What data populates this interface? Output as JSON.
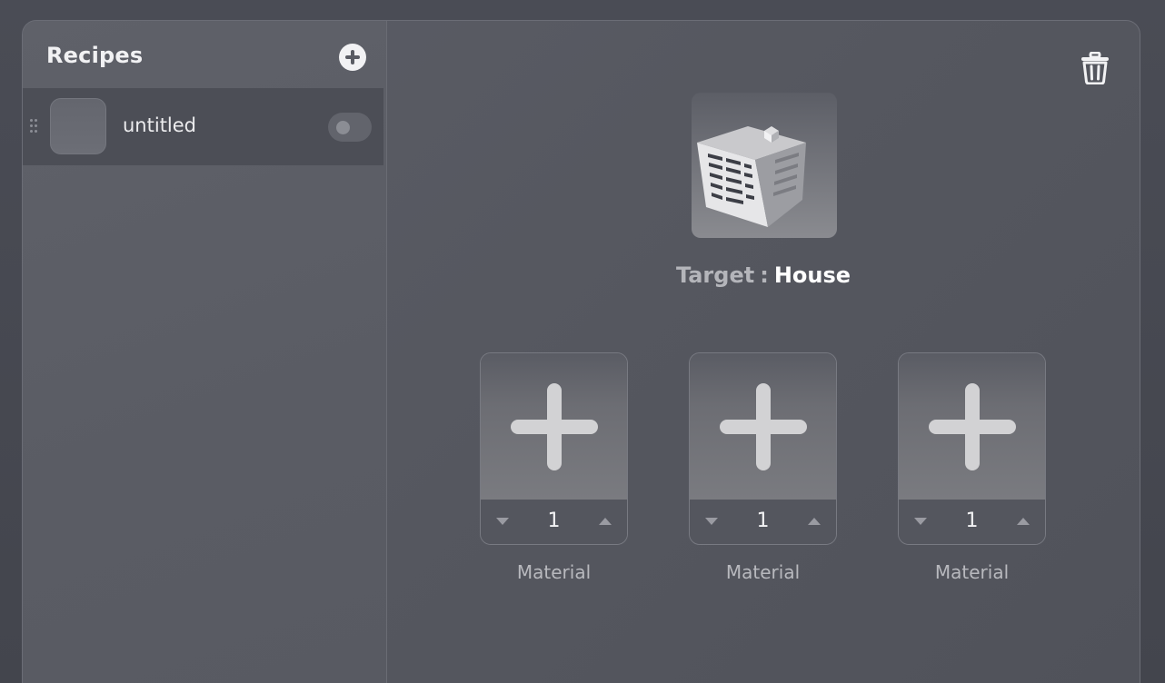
{
  "sidebar": {
    "title": "Recipes",
    "add_icon": "plus-circle-icon",
    "items": [
      {
        "label": "untitled",
        "enabled": false
      }
    ]
  },
  "main": {
    "delete_icon": "trash-icon",
    "target": {
      "prefix": "Target",
      "separator": ":",
      "name": "House",
      "image": "building-icon"
    },
    "materials": [
      {
        "label": "Material",
        "quantity": "1"
      },
      {
        "label": "Material",
        "quantity": "1"
      },
      {
        "label": "Material",
        "quantity": "1"
      }
    ]
  },
  "colors": {
    "background": "#4a4c55",
    "panel": "#5a5c64",
    "selected_row": "#4c4e56",
    "text_primary": "#f1f1f3",
    "text_secondary": "#b8b9be"
  }
}
